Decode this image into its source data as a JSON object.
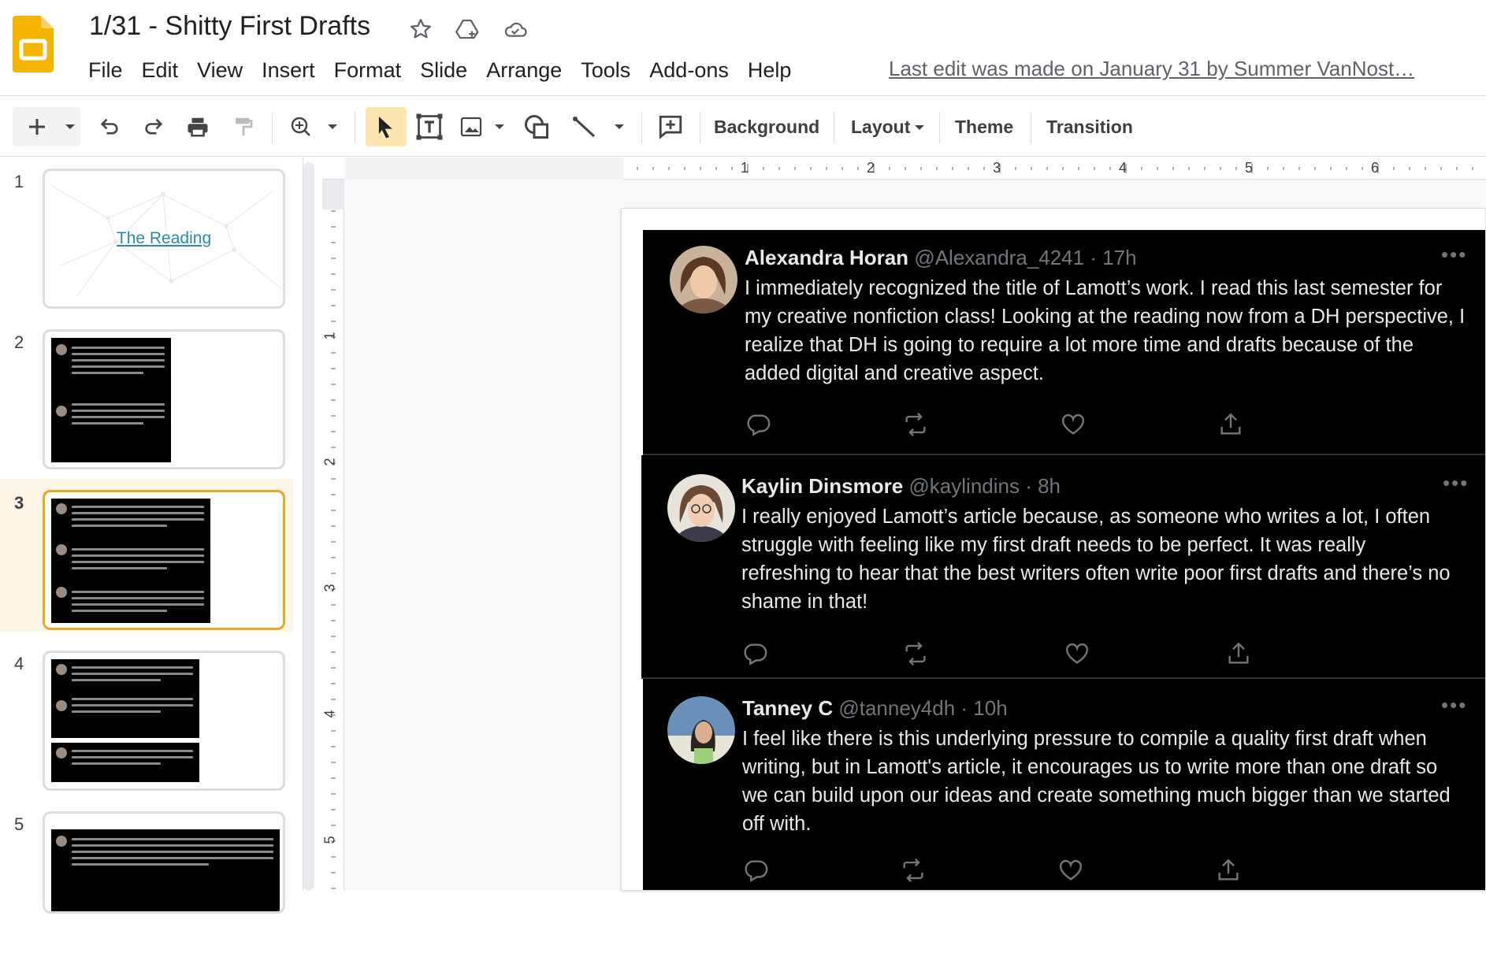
{
  "header": {
    "title": "1/31 - Shitty First Drafts",
    "last_edit": "Last edit was made on January 31 by Summer VanNost…",
    "menu": [
      "File",
      "Edit",
      "View",
      "Insert",
      "Format",
      "Slide",
      "Arrange",
      "Tools",
      "Add-ons",
      "Help"
    ]
  },
  "toolbar": {
    "background": "Background",
    "layout": "Layout",
    "theme": "Theme",
    "transition": "Transition"
  },
  "filmstrip": {
    "slides": [
      {
        "number": "1",
        "thumb_text": "The Reading"
      },
      {
        "number": "2"
      },
      {
        "number": "3"
      },
      {
        "number": "4"
      },
      {
        "number": "5"
      }
    ]
  },
  "ruler": {
    "top": [
      "1",
      "2",
      "3",
      "4",
      "5",
      "6"
    ],
    "left": [
      "1",
      "2",
      "3",
      "4",
      "5"
    ]
  },
  "tweets": [
    {
      "name": "Alexandra Horan",
      "meta": "@Alexandra_4241 · 17h",
      "text": "I immediately recognized the title of Lamott’s work. I read this last semester for my creative nonfiction class! Looking at the reading now from a DH perspective, I realize that DH is going to require a lot more time and drafts because of the added digital and creative aspect."
    },
    {
      "name": "Kaylin Dinsmore",
      "meta": "@kaylindins · 8h",
      "text": "I really enjoyed Lamott’s article because, as someone who writes a lot, I often struggle with feeling like my first draft needs to be perfect. It was really refreshing to hear that the best writers often write poor first drafts and there’s no shame in that!"
    },
    {
      "name": "Tanney C",
      "meta": "@tanney4dh · 10h",
      "text": "I feel like there is this underlying pressure to compile a quality first draft when writing, but in Lamott's article, it encourages us to write more than one draft so we can build upon our ideas and create something much bigger than we started off with."
    }
  ],
  "colors": {
    "slides_yellow": "#f4b400",
    "selection_border": "#e8a729",
    "tweet_bg": "#000000",
    "link": "#2a8aa5"
  }
}
